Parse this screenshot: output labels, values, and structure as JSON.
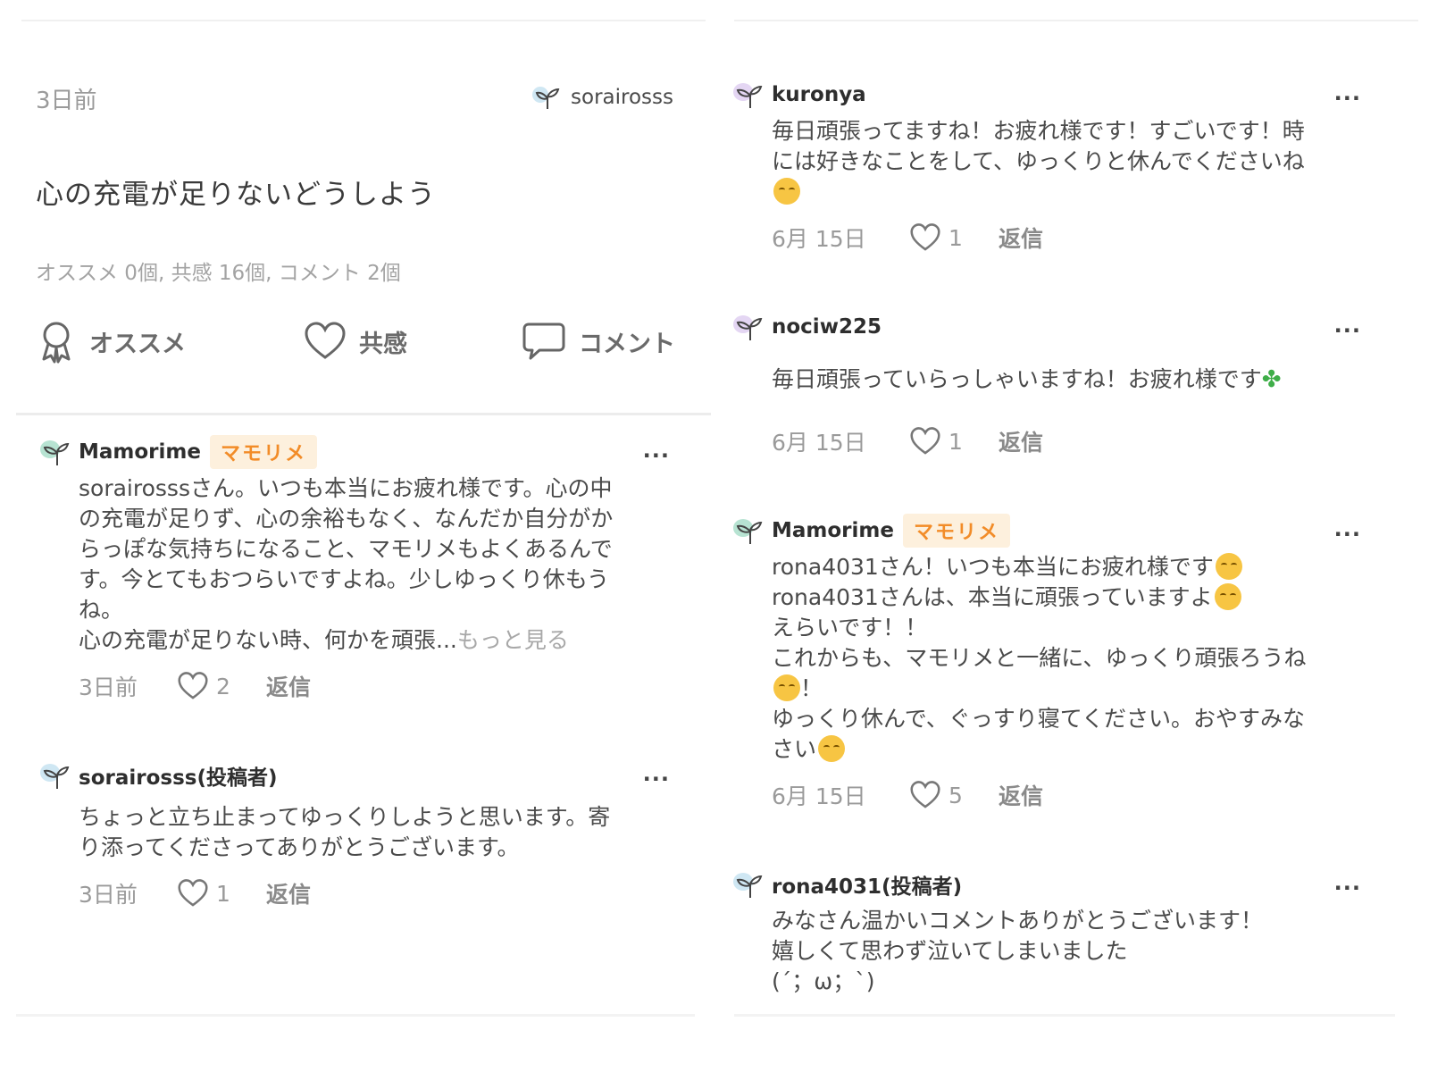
{
  "post": {
    "time": "3日前",
    "author": "sorairosss",
    "title": "心の充電が足りないどうしよう",
    "stats": "オススメ 0個, 共感 16個, コメント 2個",
    "actions": {
      "recommend": "オススメ",
      "empathy": "共感",
      "comment": "コメント"
    }
  },
  "more_label": "...",
  "reply_label": "返信",
  "left_comments": [
    {
      "name": "Mamorime",
      "badge": "マモリメ",
      "body": "sorairosssさん。いつも本当にお疲れ様です。心の中\nの充電が足りず、心の余裕もなく、なんだか自分がか\nらっぽな気持ちになること、マモリメもよくあるんで\nす。今とてもおつらいですよね。少しゆっくり休もう\nね。\n心の充電が足りない時、何かを頑張...",
      "more_link": "もっと見る",
      "date": "3日前",
      "likes": "2"
    },
    {
      "name": "sorairosss(投稿者)",
      "body": "ちょっと立ち止まってゆっくりしようと思います。寄\nり添ってくださってありがとうございます。",
      "date": "3日前",
      "likes": "1"
    }
  ],
  "right_comments": [
    {
      "name": "kuronya",
      "body": "毎日頑張ってますね！お疲れ様です！すごいです！時\nには好きなことをして、ゆっくりと休んでくださいね",
      "date": "6月 15日",
      "likes": "1"
    },
    {
      "name": "nociw225",
      "body": "毎日頑張っていらっしゃいますね！お疲れ様です",
      "date": "6月 15日",
      "likes": "1"
    },
    {
      "name": "Mamorime",
      "badge": "マモリメ",
      "lines": [
        "rona4031さん！いつも本当にお疲れ様です",
        "rona4031さんは、本当に頑張っていますよ",
        "えらいです！！",
        "これからも、マモリメと一緒に、ゆっくり頑張ろうね",
        "！",
        "ゆっくり休んで、ぐっすり寝てください。おやすみな",
        "さい"
      ],
      "date": "6月 15日",
      "likes": "5"
    },
    {
      "name": "rona4031(投稿者)",
      "body": "みなさん温かいコメントありがとうございます！\n嬉しくて思わず泣いてしまいました\n(´；ω；`)"
    }
  ],
  "icons": {
    "avatar_leaf_color": "#7fcbb6",
    "accent_orange": "#f28c28",
    "badge_bg": "#fdf0dd",
    "emoji": "smiling-face-icon",
    "clover": "four-leaf-clover-icon"
  }
}
